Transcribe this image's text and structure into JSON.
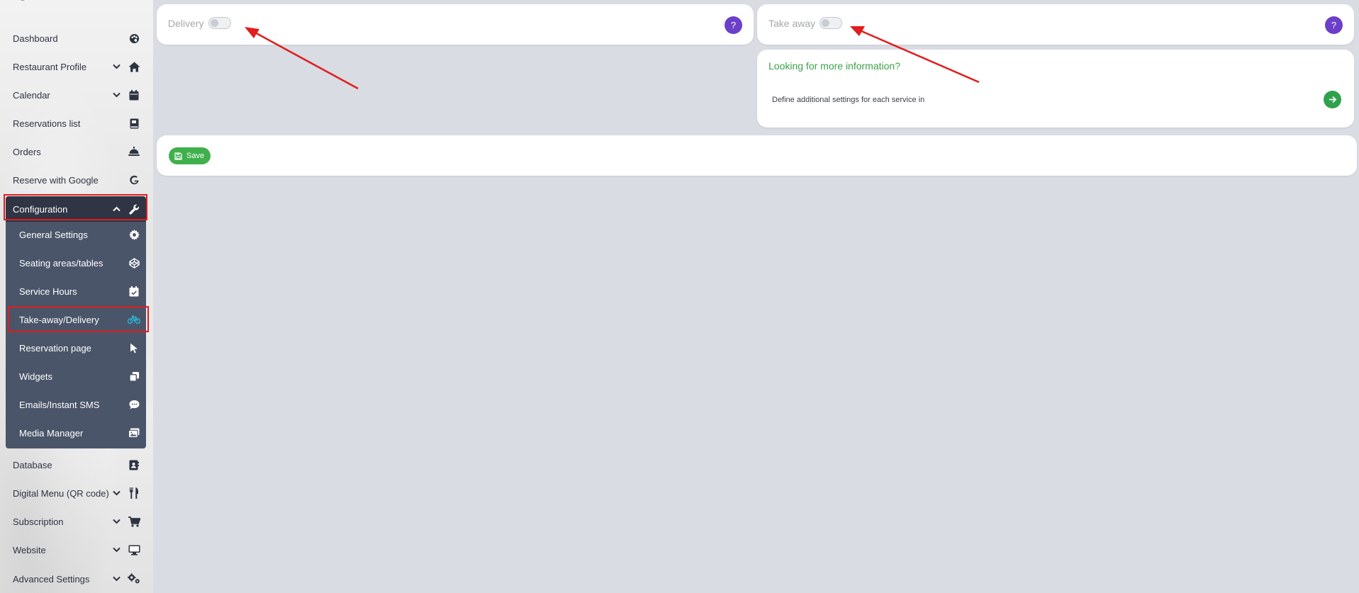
{
  "sidebar": {
    "items": [
      {
        "label": "Dashboard",
        "icon": "palette-icon"
      },
      {
        "label": "Restaurant Profile",
        "icon": "home-icon"
      },
      {
        "label": "Calendar",
        "icon": "calendar-icon"
      },
      {
        "label": "Reservations list",
        "icon": "book-icon"
      },
      {
        "label": "Orders",
        "icon": "bell-service-icon"
      },
      {
        "label": "Reserve with Google",
        "icon": "google-icon"
      },
      {
        "label": "Configuration",
        "icon": "wrench-icon"
      }
    ],
    "submenu": [
      {
        "label": "General Settings",
        "icon": "gear-icon"
      },
      {
        "label": "Seating areas/tables",
        "icon": "codepen-icon"
      },
      {
        "label": "Service Hours",
        "icon": "calendar-check-icon"
      },
      {
        "label": "Take-away/Delivery",
        "icon": "bicycle-icon"
      },
      {
        "label": "Reservation page",
        "icon": "cursor-icon"
      },
      {
        "label": "Widgets",
        "icon": "clone-icon"
      },
      {
        "label": "Emails/Instant SMS",
        "icon": "chat-icon"
      },
      {
        "label": "Media Manager",
        "icon": "images-icon"
      }
    ],
    "bottom_items": [
      {
        "label": "Database",
        "icon": "address-book-icon"
      },
      {
        "label": "Digital Menu (QR code)",
        "icon": "utensils-icon"
      },
      {
        "label": "Subscription",
        "icon": "cart-icon"
      },
      {
        "label": "Website",
        "icon": "monitor-icon"
      },
      {
        "label": "Advanced Settings",
        "icon": "gears-icon"
      }
    ]
  },
  "delivery": {
    "label": "Delivery",
    "help": "?"
  },
  "takeaway": {
    "label": "Take away",
    "help": "?"
  },
  "info": {
    "title": "Looking for more information?",
    "text": "Define additional settings for each service in"
  },
  "save": {
    "label": "Save"
  },
  "colors": {
    "accent_green": "#3fb04c",
    "help_purple": "#6b3fc9",
    "submenu_bg": "#4a5569",
    "config_bg": "#2f3544",
    "highlight_red": "#e11d1d",
    "active_icon": "#29b6d8"
  }
}
